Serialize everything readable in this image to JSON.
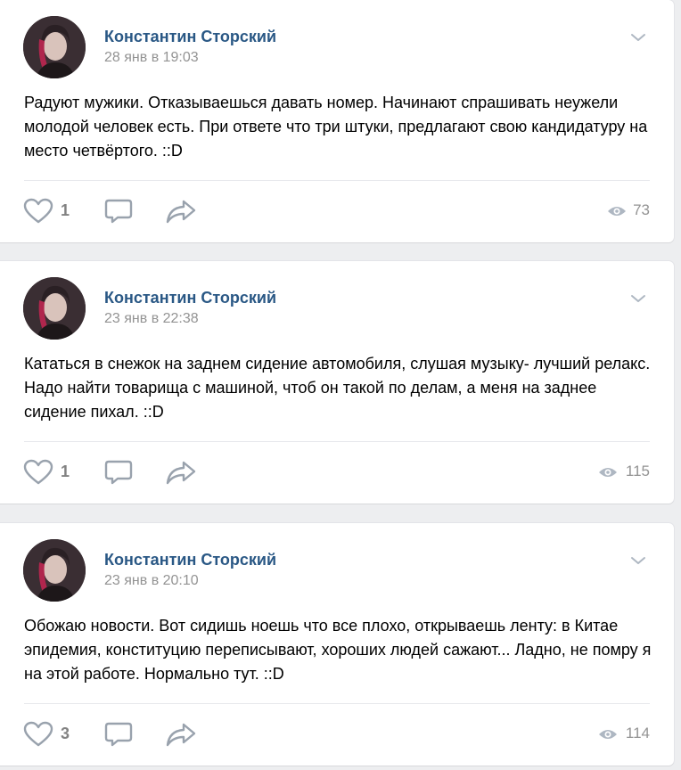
{
  "posts": [
    {
      "author": "Константин Сторский",
      "date": "28 янв в 19:03",
      "text": "Радуют мужики. Отказываешься давать номер. Начинают спрашивать неужели молодой человек есть. При ответе что три штуки, предлагают свою кандидатуру на место четвёртого. ::D",
      "likes": "1",
      "views": "73"
    },
    {
      "author": "Константин Сторский",
      "date": "23 янв в 22:38",
      "text": "Кататься в снежок на заднем сидение автомобиля, слушая музыку- лучший релакс. Надо найти товарища с машиной, чтоб он такой по делам, а меня на заднее сидение пихал. ::D",
      "likes": "1",
      "views": "115"
    },
    {
      "author": "Константин Сторский",
      "date": "23 янв в 20:10",
      "text": "Обожаю новости. Вот сидишь ноешь что все плохо, открываешь ленту: в Китае эпидемия, конституцию переписывают, хороших людей сажают... Ладно, не помру я на этой работе. Нормально тут. ::D",
      "likes": "3",
      "views": "114"
    }
  ],
  "icons": {
    "like": "heart-outline-icon",
    "comment": "speech-bubble-icon",
    "share": "share-arrow-icon",
    "views": "eye-icon",
    "menu": "chevron-down-icon"
  },
  "colors": {
    "author": "#2a5885",
    "meta": "#939393",
    "icon": "#99a2ad",
    "background": "#edeef0"
  }
}
